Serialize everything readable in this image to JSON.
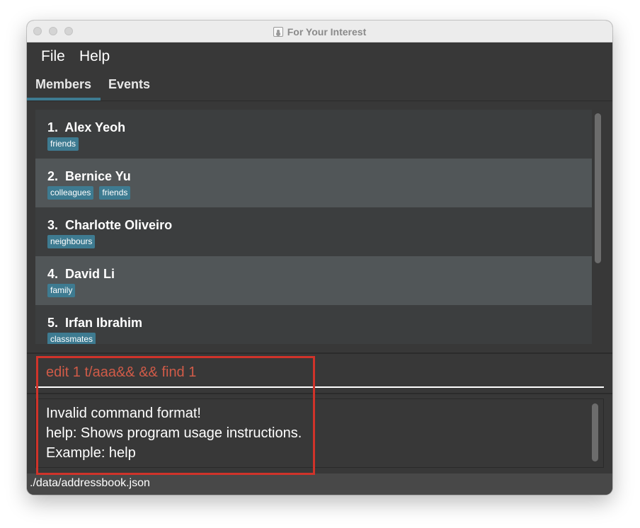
{
  "window": {
    "title": "For Your Interest"
  },
  "menu": {
    "file": "File",
    "help": "Help"
  },
  "tabs": {
    "members": "Members",
    "events": "Events",
    "selected": "Members"
  },
  "members": [
    {
      "index": "1.",
      "name": "Alex Yeoh",
      "tags": [
        "friends"
      ]
    },
    {
      "index": "2.",
      "name": "Bernice Yu",
      "tags": [
        "colleagues",
        "friends"
      ]
    },
    {
      "index": "3.",
      "name": "Charlotte Oliveiro",
      "tags": [
        "neighbours"
      ]
    },
    {
      "index": "4.",
      "name": "David Li",
      "tags": [
        "family"
      ]
    },
    {
      "index": "5.",
      "name": "Irfan Ibrahim",
      "tags": [
        "classmates"
      ]
    }
  ],
  "command": {
    "value": "edit 1 t/aaa&& && find 1",
    "state": "error"
  },
  "result": {
    "lines": [
      "Invalid command format!",
      "help: Shows program usage instructions.",
      "Example: help"
    ]
  },
  "status": {
    "path": "./data/addressbook.json"
  },
  "colors": {
    "tag_bg": "#3e7b91",
    "error_text": "#d05b48",
    "highlight": "#d0332a",
    "card_odd": "#3c3e3f",
    "card_even": "#515658"
  }
}
